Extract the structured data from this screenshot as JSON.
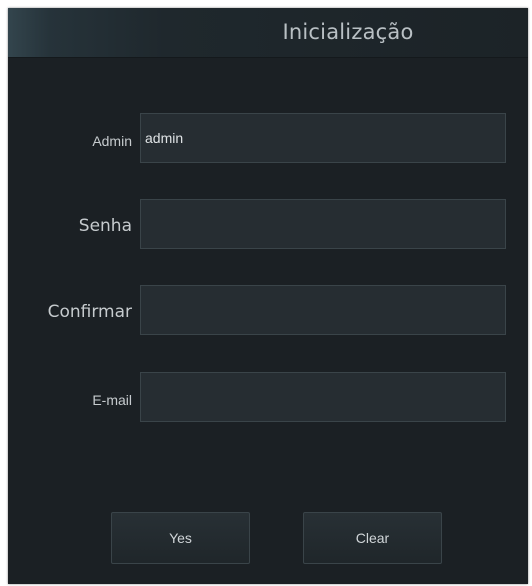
{
  "dialog": {
    "title": "Inicialização"
  },
  "form": {
    "admin": {
      "label": "Admin",
      "value": "admin",
      "placeholder": ""
    },
    "password": {
      "label": "Senha",
      "value": "",
      "placeholder": ""
    },
    "confirm": {
      "label": "Confirmar",
      "value": "",
      "placeholder": ""
    },
    "email": {
      "label": "E-mail",
      "value": "",
      "placeholder": ""
    }
  },
  "buttons": {
    "yes": "Yes",
    "clear": "Clear"
  },
  "colors": {
    "background": "#1b2024",
    "field_background": "#262d32",
    "text": "#c6cbce"
  }
}
